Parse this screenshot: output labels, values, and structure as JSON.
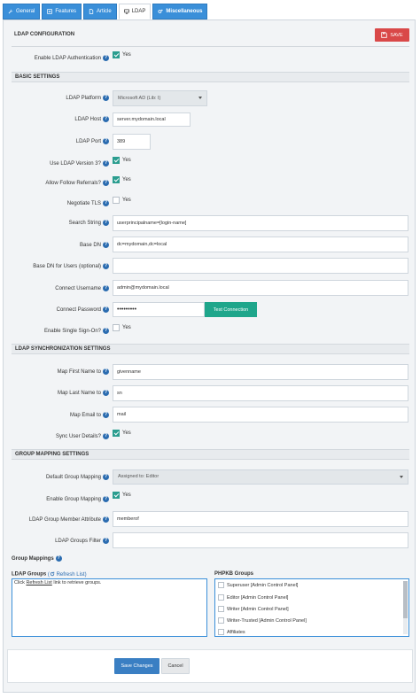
{
  "tabs": [
    {
      "label": "General",
      "icon": "wrench-icon"
    },
    {
      "label": "Features",
      "icon": "list-icon"
    },
    {
      "label": "Article",
      "icon": "document-icon"
    },
    {
      "label": "LDAP",
      "icon": "monitor-icon"
    },
    {
      "label": "Miscellaneous",
      "icon": "gears-icon"
    }
  ],
  "header": {
    "title": "LDAP CONFIGURATION",
    "save_label": "SAVE"
  },
  "enable_ldap": {
    "label": "Enable LDAP Authentication",
    "value": "Yes"
  },
  "basic": {
    "title": "BASIC SETTINGS",
    "platform": {
      "label": "LDAP Platform",
      "value": "Microsoft AD (Lib: I)"
    },
    "host": {
      "label": "LDAP Host",
      "value": "server.mydomain.local"
    },
    "port": {
      "label": "LDAP Port",
      "value": "389"
    },
    "v3": {
      "label": "Use LDAP Version 3?",
      "value": "Yes"
    },
    "referrals": {
      "label": "Allow Follow Referrals?",
      "value": "Yes"
    },
    "tls": {
      "label": "Negotiate TLS",
      "value": "Yes"
    },
    "search": {
      "label": "Search String",
      "value": "userprincipalname=[login-name]"
    },
    "basedn": {
      "label": "Base DN",
      "value": "dc=mydomain,dc=local"
    },
    "basedn_users": {
      "label": "Base DN for Users (optional)",
      "value": ""
    },
    "username": {
      "label": "Connect Username",
      "value": "admin@mydomain.local"
    },
    "password": {
      "label": "Connect Password",
      "value": "•••••••••",
      "test_label": "Test Connection"
    },
    "sso": {
      "label": "Enable Single Sign-On?",
      "value": "Yes"
    }
  },
  "sync": {
    "title": "LDAP SYNCHRONIZATION SETTINGS",
    "first": {
      "label": "Map First Name to",
      "value": "givenname"
    },
    "last": {
      "label": "Map Last Name to",
      "value": "sn"
    },
    "email": {
      "label": "Map Email to",
      "value": "mail"
    },
    "details": {
      "label": "Sync User Details?",
      "value": "Yes"
    }
  },
  "group": {
    "title": "GROUP MAPPING SETTINGS",
    "default": {
      "label": "Default Group Mapping",
      "value": "Assigned to: Editor"
    },
    "enable": {
      "label": "Enable Group Mapping",
      "value": "Yes"
    },
    "attribute": {
      "label": "LDAP Group Member Attribute",
      "value": "memberof"
    },
    "filter": {
      "label": "LDAP Groups Filter",
      "value": ""
    },
    "mappings_label": "Group Mappings",
    "ldap_groups_label": "LDAP Groups",
    "refresh_label": "Refresh List",
    "hint_prefix": "Click ",
    "hint_link": "Refresh List",
    "hint_suffix": " link to retrieve groups.",
    "phpkb_label": "PHPKB Groups",
    "phpkb_items": [
      "Superuser [Admin Control Panel]",
      "Editor [Admin Control Panel]",
      "Writer [Admin Control Panel]",
      "Writer-Trusted [Admin Control Panel]",
      "Affiliates"
    ]
  },
  "footer": {
    "save_label": "Save Changes",
    "cancel_label": "Cancel"
  }
}
